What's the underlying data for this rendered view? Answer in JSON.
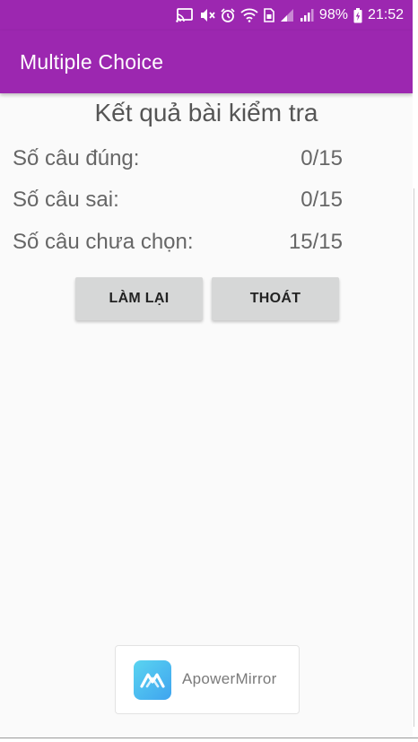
{
  "status_bar": {
    "battery_percent": "98%",
    "time": "21:52",
    "icons": [
      "cast-icon",
      "mute-icon",
      "alarm-icon",
      "wifi-icon",
      "sim-icon",
      "signal-icon",
      "signal-icon",
      "battery-charging-icon"
    ]
  },
  "app_bar": {
    "title": "Multiple Choice",
    "color": "#9c27b0"
  },
  "result": {
    "title": "Kết quả bài kiểm tra",
    "rows": [
      {
        "label": "Số câu đúng:",
        "value": "0/15"
      },
      {
        "label": "Số câu sai:",
        "value": "0/15"
      },
      {
        "label": "Số câu chưa chọn:",
        "value": "15/15"
      }
    ]
  },
  "buttons": {
    "retry_label": "LÀM LẠI",
    "exit_label": "THOÁT"
  },
  "watermark": {
    "text": "ApowerMirror",
    "icon": "apowermirror-logo-icon"
  }
}
